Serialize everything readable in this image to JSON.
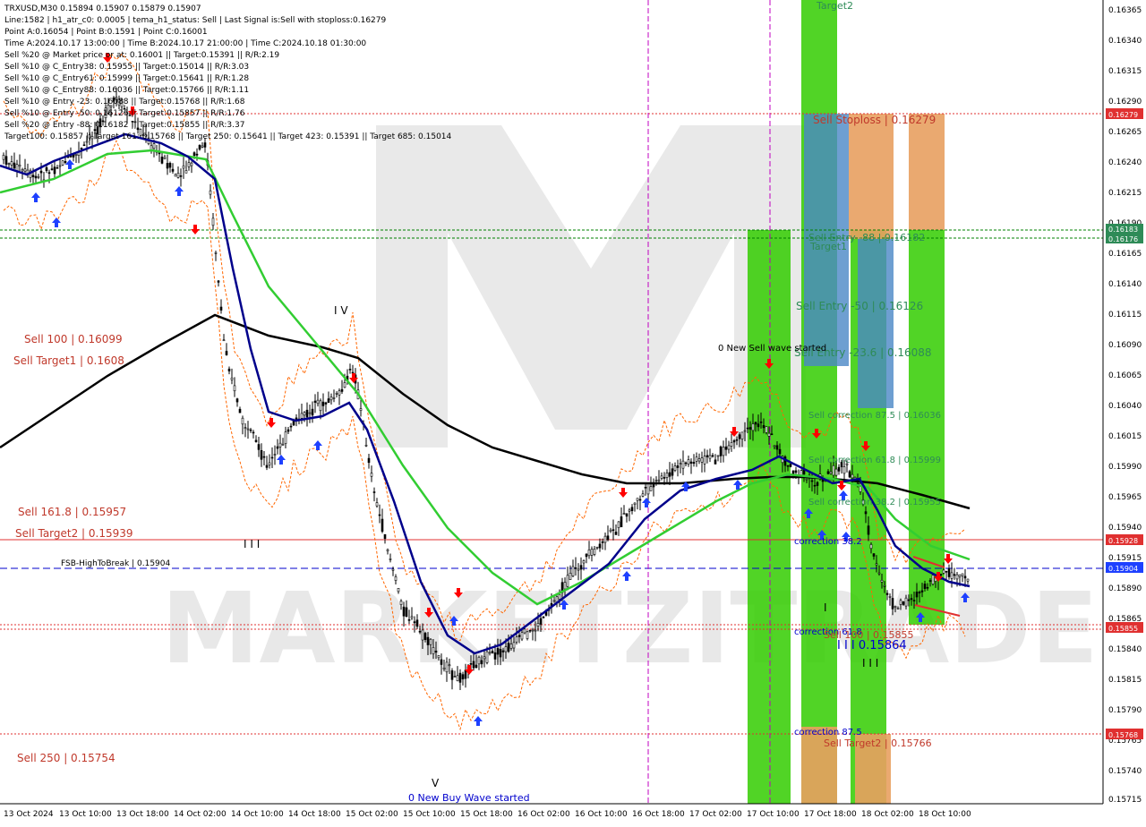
{
  "header": {
    "symbol": "TRXUSD,M30",
    "ohlc": "0.15894 0.15907 0.15879 0.15907",
    "lines": [
      "Line:1582 | h1_atr_c0: 0.0005 | tema_h1_status: Sell | Last Signal is:Sell with stoploss:0.16279",
      "Point A:0.16054 | Point B:0.1591 | Point C:0.16001",
      "Time A:2024.10.17 13:00:00 | Time B:2024.10.17 21:00:00 | Time C:2024.10.18 01:30:00",
      "Sell %20 @ Market price or at: 0.16001 || Target:0.15391 || R/R:2.19",
      "Sell %10 @ C_Entry38: 0.15955 || Target:0.15014 || R/R:3.03",
      "Sell %10 @ C_Entry61: 0.15999 || Target:0.15641 || R/R:1.28",
      "Sell %10 @ C_Entry88: 0.16036 || Target:0.15766 || R/R:1.11",
      "Sell %10 @ Entry -23: 0.16088 || Target:0.15768 || R/R:1.68",
      "Sell %10 @ Entry -50: 0.16126 || Target:0.15857 || R/R:1.76",
      "Sell %20 @ Entry -88: 0.16182 || Target:0.15855 || R/R:3.37",
      "Target100: 0.15857 || Target 161: 0.15768 || Target 250: 0.15641 || Target 423: 0.15391 || Target 685: 0.15014"
    ]
  },
  "watermark": "MARKETZITRADE",
  "colors": {
    "background": "#ffffff",
    "grid": "#c0c0c0",
    "bull_candle": "#000000",
    "bear_candle": "#000000",
    "black_ma": "#000000",
    "navy_ma": "#00008b",
    "green_ma": "#32cd32",
    "stop_band": "#ff6600",
    "green_zone": "#33cc00",
    "sell_label": "#c0392b",
    "sell_arrow": "#ff0000",
    "buy_arrow": "#1e40ff",
    "red_line": "#e03030",
    "blue_dash": "#0000cd",
    "green_dash": "#008000"
  },
  "price_axis": {
    "ticks": [
      "0.16365",
      "0.16340",
      "0.16315",
      "0.16290",
      "0.16265",
      "0.16240",
      "0.16215",
      "0.16190",
      "0.16165",
      "0.16140",
      "0.16115",
      "0.16090",
      "0.16065",
      "0.16040",
      "0.16015",
      "0.15990",
      "0.15965",
      "0.15940",
      "0.15915",
      "0.15890",
      "0.15865",
      "0.15840",
      "0.15815",
      "0.15790",
      "0.15765",
      "0.15740",
      "0.15715"
    ],
    "tags": [
      {
        "text": "0.16279",
        "color": "#e03030"
      },
      {
        "text": "0.16183",
        "color": "#2e8b57"
      },
      {
        "text": "0.16176",
        "color": "#2e8b57"
      },
      {
        "text": "0.15928",
        "color": "#e03030"
      },
      {
        "text": "0.15904",
        "color": "#1e40ff"
      },
      {
        "text": "0.15855",
        "color": "#e03030"
      },
      {
        "text": "0.15768",
        "color": "#e03030"
      }
    ]
  },
  "time_axis": [
    "13 Oct 2024",
    "13 Oct 10:00",
    "13 Oct 18:00",
    "14 Oct 02:00",
    "14 Oct 10:00",
    "14 Oct 18:00",
    "15 Oct 02:00",
    "15 Oct 10:00",
    "15 Oct 18:00",
    "16 Oct 02:00",
    "16 Oct 10:00",
    "16 Oct 18:00",
    "17 Oct 02:00",
    "17 Oct 10:00",
    "17 Oct 18:00",
    "18 Oct 02:00",
    "18 Oct 10:00"
  ],
  "left_labels": [
    {
      "text": "Sell 100 | 0.16099"
    },
    {
      "text": "Sell Target1 | 0.1608"
    },
    {
      "text": "Sell 161.8 | 0.15957"
    },
    {
      "text": "Sell Target2 | 0.15939"
    },
    {
      "text": "Sell 250 | 0.15754"
    }
  ],
  "fsb_label": "FSB-HighToBreak | 0.15904",
  "chart_labels": {
    "target2": "Target2",
    "stoploss": "Sell Stoploss | 0.16279",
    "entry88": "Sell Entry -88 | 0.16182",
    "target1": "Target1",
    "entry50": "Sell Entry -50 | 0.16126",
    "entry23": "Sell Entry -23.6 | 0.16088",
    "new_sell": "0 New Sell wave started",
    "corr88": "Sell correction 87.5 | 0.16036",
    "corr61": "Sell correction 61.8 | 0.15999",
    "corr38": "Sell correction 38.2 | 0.15955",
    "corr382b": "correction 38.2",
    "corr618": "correction 61.8",
    "target100": "Sell 100 | 0.15855",
    "corr875": "correction 87.5",
    "target2b": "Sell Target2 | 0.15766",
    "wave_iv": "I V",
    "wave_v": "V",
    "wave_iii_a": "I I I",
    "wave_iii_b": "I I I",
    "wave_i": "I",
    "point_label": "I I I 0.15864",
    "new_buy": "0 New Buy Wave started"
  }
}
